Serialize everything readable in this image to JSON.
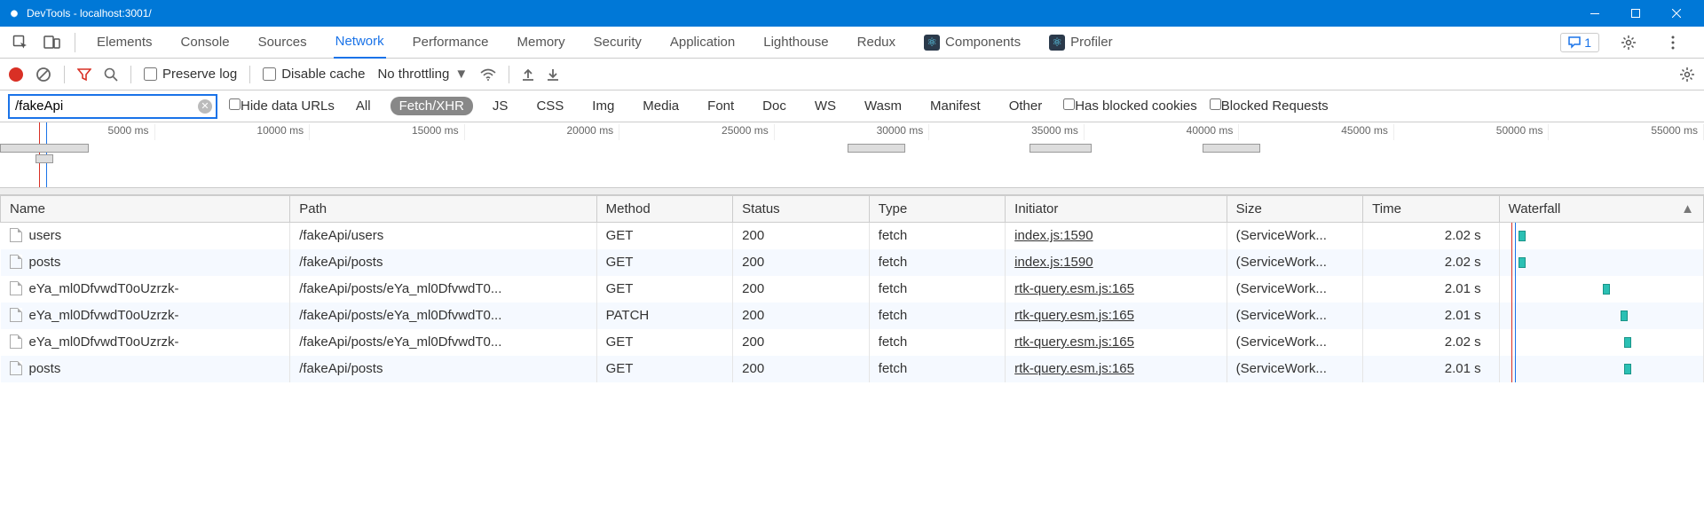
{
  "window": {
    "title": "DevTools - localhost:3001/"
  },
  "tabs": [
    "Elements",
    "Console",
    "Sources",
    "Network",
    "Performance",
    "Memory",
    "Security",
    "Application",
    "Lighthouse",
    "Redux",
    "Components",
    "Profiler"
  ],
  "activeTab": "Network",
  "reactTabs": [
    "Components",
    "Profiler"
  ],
  "errorBadge": {
    "count": "1"
  },
  "toolbar2": {
    "preserve": "Preserve log",
    "disable": "Disable cache",
    "throttle": "No throttling"
  },
  "filter": {
    "value": "/fakeApi",
    "hideData": "Hide data URLs",
    "chips": [
      "All",
      "Fetch/XHR",
      "JS",
      "CSS",
      "Img",
      "Media",
      "Font",
      "Doc",
      "WS",
      "Wasm",
      "Manifest",
      "Other"
    ],
    "activeChip": "Fetch/XHR",
    "blockedCookies": "Has blocked cookies",
    "blockedReq": "Blocked Requests"
  },
  "timelineTicks": [
    "5000 ms",
    "10000 ms",
    "15000 ms",
    "20000 ms",
    "25000 ms",
    "30000 ms",
    "35000 ms",
    "40000 ms",
    "45000 ms",
    "50000 ms",
    "55000 ms"
  ],
  "columns": [
    "Name",
    "Path",
    "Method",
    "Status",
    "Type",
    "Initiator",
    "Size",
    "Time",
    "Waterfall"
  ],
  "rows": [
    {
      "name": "users",
      "path": "/fakeApi/users",
      "method": "GET",
      "status": "200",
      "type": "fetch",
      "initiator": "index.js:1590",
      "size": "(ServiceWork...",
      "time": "2.02 s",
      "wfLeft": 11,
      "wfW": 8
    },
    {
      "name": "posts",
      "path": "/fakeApi/posts",
      "method": "GET",
      "status": "200",
      "type": "fetch",
      "initiator": "index.js:1590",
      "size": "(ServiceWork...",
      "time": "2.02 s",
      "wfLeft": 11,
      "wfW": 8
    },
    {
      "name": "eYa_ml0DfvwdT0oUzrzk-",
      "path": "/fakeApi/posts/eYa_ml0DfvwdT0...",
      "method": "GET",
      "status": "200",
      "type": "fetch",
      "initiator": "rtk-query.esm.js:165",
      "size": "(ServiceWork...",
      "time": "2.01 s",
      "wfLeft": 106,
      "wfW": 8
    },
    {
      "name": "eYa_ml0DfvwdT0oUzrzk-",
      "path": "/fakeApi/posts/eYa_ml0DfvwdT0...",
      "method": "PATCH",
      "status": "200",
      "type": "fetch",
      "initiator": "rtk-query.esm.js:165",
      "size": "(ServiceWork...",
      "time": "2.01 s",
      "wfLeft": 126,
      "wfW": 8
    },
    {
      "name": "eYa_ml0DfvwdT0oUzrzk-",
      "path": "/fakeApi/posts/eYa_ml0DfvwdT0...",
      "method": "GET",
      "status": "200",
      "type": "fetch",
      "initiator": "rtk-query.esm.js:165",
      "size": "(ServiceWork...",
      "time": "2.02 s",
      "wfLeft": 130,
      "wfW": 8
    },
    {
      "name": "posts",
      "path": "/fakeApi/posts",
      "method": "GET",
      "status": "200",
      "type": "fetch",
      "initiator": "rtk-query.esm.js:165",
      "size": "(ServiceWork...",
      "time": "2.01 s",
      "wfLeft": 130,
      "wfW": 8
    }
  ]
}
